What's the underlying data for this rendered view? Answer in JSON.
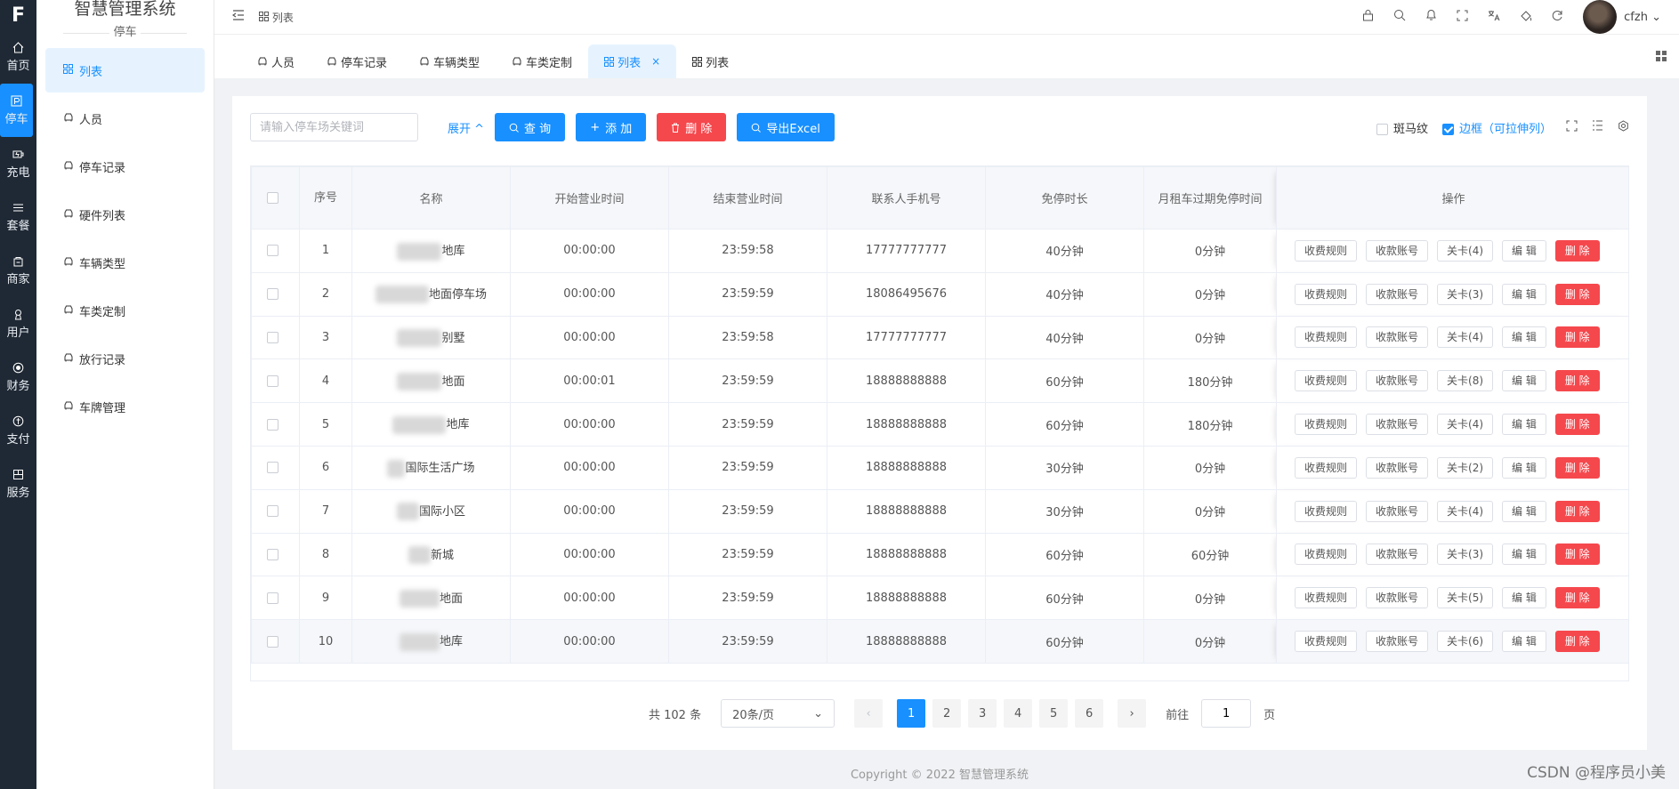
{
  "app": {
    "logo": "F",
    "title": "智慧管理系统"
  },
  "rail": [
    {
      "label": "首页",
      "icon": "home-icon"
    },
    {
      "label": "停车",
      "icon": "parking-icon",
      "active": true
    },
    {
      "label": "充电",
      "icon": "charge-icon"
    },
    {
      "label": "套餐",
      "icon": "package-icon"
    },
    {
      "label": "商家",
      "icon": "shop-icon"
    },
    {
      "label": "用户",
      "icon": "user-icon"
    },
    {
      "label": "财务",
      "icon": "finance-icon"
    },
    {
      "label": "支付",
      "icon": "pay-icon"
    },
    {
      "label": "服务",
      "icon": "service-icon"
    }
  ],
  "subnav": {
    "group": "停车",
    "items": [
      {
        "label": "列表",
        "active": true
      },
      {
        "label": "人员"
      },
      {
        "label": "停车记录"
      },
      {
        "label": "硬件列表"
      },
      {
        "label": "车辆类型"
      },
      {
        "label": "车类定制"
      },
      {
        "label": "放行记录"
      },
      {
        "label": "车牌管理"
      }
    ]
  },
  "header": {
    "breadcrumb": "列表",
    "username": "cfzh"
  },
  "tabs": [
    {
      "label": "人员"
    },
    {
      "label": "停车记录"
    },
    {
      "label": "车辆类型"
    },
    {
      "label": "车类定制"
    },
    {
      "label": "列表",
      "active": true,
      "closable": true
    },
    {
      "label": "列表"
    }
  ],
  "toolbar": {
    "search_placeholder": "请输入停车场关键词",
    "expand_label": "展开",
    "query_label": "查 询",
    "add_label": "添 加",
    "delete_label": "删 除",
    "export_label": "导出Excel",
    "zebra_label": "斑马纹",
    "border_label": "边框（可拉伸列）"
  },
  "table": {
    "columns": [
      "序号",
      "名称",
      "开始营业时间",
      "结束营业时间",
      "联系人手机号",
      "免停时长",
      "月租车过期免停时间",
      "操作"
    ],
    "rows": [
      {
        "no": "1",
        "name": "地库",
        "start": "00:00:00",
        "end": "23:59:58",
        "phone": "17777777777",
        "free": "40分钟",
        "expired_free": "0分钟",
        "gate": "关卡(4)"
      },
      {
        "no": "2",
        "name": "地面停车场",
        "start": "00:00:00",
        "end": "23:59:59",
        "phone": "18086495676",
        "free": "40分钟",
        "expired_free": "0分钟",
        "gate": "关卡(3)"
      },
      {
        "no": "3",
        "name": "别墅",
        "start": "00:00:00",
        "end": "23:59:58",
        "phone": "17777777777",
        "free": "40分钟",
        "expired_free": "0分钟",
        "gate": "关卡(4)"
      },
      {
        "no": "4",
        "name": "地面",
        "start": "00:00:01",
        "end": "23:59:59",
        "phone": "18888888888",
        "free": "60分钟",
        "expired_free": "180分钟",
        "gate": "关卡(8)"
      },
      {
        "no": "5",
        "name": "地库",
        "start": "00:00:00",
        "end": "23:59:59",
        "phone": "18888888888",
        "free": "60分钟",
        "expired_free": "180分钟",
        "gate": "关卡(4)"
      },
      {
        "no": "6",
        "name": "国际生活广场",
        "start": "00:00:00",
        "end": "23:59:59",
        "phone": "18888888888",
        "free": "30分钟",
        "expired_free": "0分钟",
        "gate": "关卡(2)"
      },
      {
        "no": "7",
        "name": "国际小区",
        "start": "00:00:00",
        "end": "23:59:59",
        "phone": "18888888888",
        "free": "30分钟",
        "expired_free": "0分钟",
        "gate": "关卡(4)"
      },
      {
        "no": "8",
        "name": "新城",
        "start": "00:00:00",
        "end": "23:59:59",
        "phone": "18888888888",
        "free": "60分钟",
        "expired_free": "60分钟",
        "gate": "关卡(3)"
      },
      {
        "no": "9",
        "name": "地面",
        "start": "00:00:00",
        "end": "23:59:59",
        "phone": "18888888888",
        "free": "60分钟",
        "expired_free": "0分钟",
        "gate": "关卡(5)"
      },
      {
        "no": "10",
        "name": "地库",
        "start": "00:00:00",
        "end": "23:59:59",
        "phone": "18888888888",
        "free": "60分钟",
        "expired_free": "0分钟",
        "gate": "关卡(6)"
      }
    ],
    "op_labels": {
      "fee_rule": "收费规则",
      "account": "收款账号",
      "edit": "编 辑",
      "delete": "删 除"
    }
  },
  "pager": {
    "total_text": "共 102 条",
    "page_size": "20条/页",
    "pages": [
      "1",
      "2",
      "3",
      "4",
      "5",
      "6"
    ],
    "current": 1,
    "goto_label": "前往",
    "goto_value": "1",
    "page_suffix": "页"
  },
  "footer": {
    "copyright": "Copyright © 2022 智慧管理系统"
  },
  "watermark": "CSDN @程序员小美"
}
